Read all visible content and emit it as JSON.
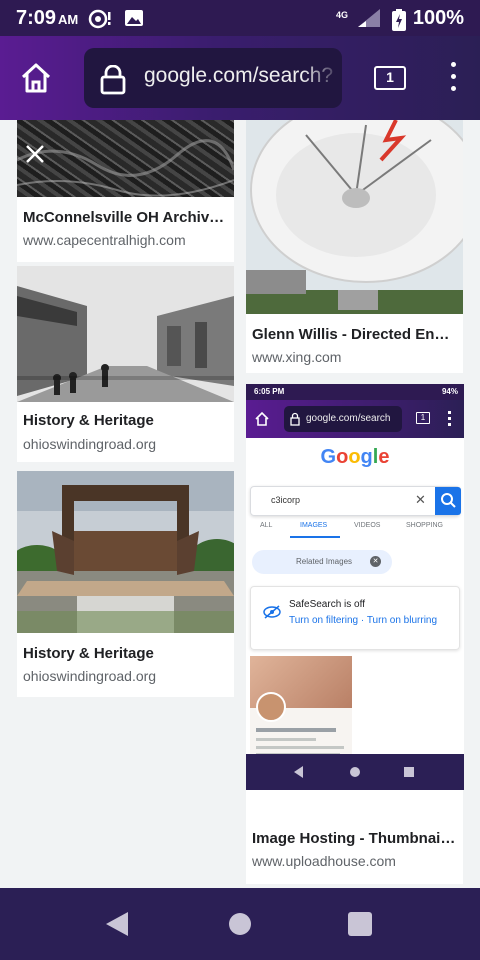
{
  "status_bar": {
    "time": "7:09",
    "ampm": "AM",
    "network": "4G",
    "battery": "100%"
  },
  "toolbar": {
    "url": "google.com/search?",
    "tab_count": "1"
  },
  "results": [
    {
      "title": "McConnelsville OH Archive…",
      "source": "www.capecentralhigh.com"
    },
    {
      "title": "History & Heritage",
      "source": "ohioswindingroad.org"
    },
    {
      "title": "History & Heritage",
      "source": "ohioswindingroad.org"
    },
    {
      "title": "Glenn Willis - Directed Ener…",
      "source": "www.xing.com"
    },
    {
      "title": "Image Hosting - Thumbnail …",
      "source": "www.uploadhouse.com"
    }
  ],
  "inner_screenshot": {
    "time": "6:05",
    "ampm": "PM",
    "battery": "94%",
    "url": "google.com/search",
    "tab_count": "1",
    "logo": [
      "G",
      "o",
      "o",
      "g",
      "l",
      "e"
    ],
    "logo_colors": [
      "#4285f4",
      "#ea4335",
      "#fbbc05",
      "#4285f4",
      "#34a853",
      "#ea4335"
    ],
    "query": "c3icorp",
    "tabs": [
      "ALL",
      "IMAGES",
      "VIDEOS",
      "SHOPPING"
    ],
    "chip": "Related Images",
    "safesearch_title": "SafeSearch is off",
    "safesearch_links": "Turn on filtering · Turn on blurring"
  },
  "icons": {
    "home": "home-icon",
    "lock": "lock-icon",
    "menu": "more-vert-icon",
    "close": "close-icon"
  }
}
